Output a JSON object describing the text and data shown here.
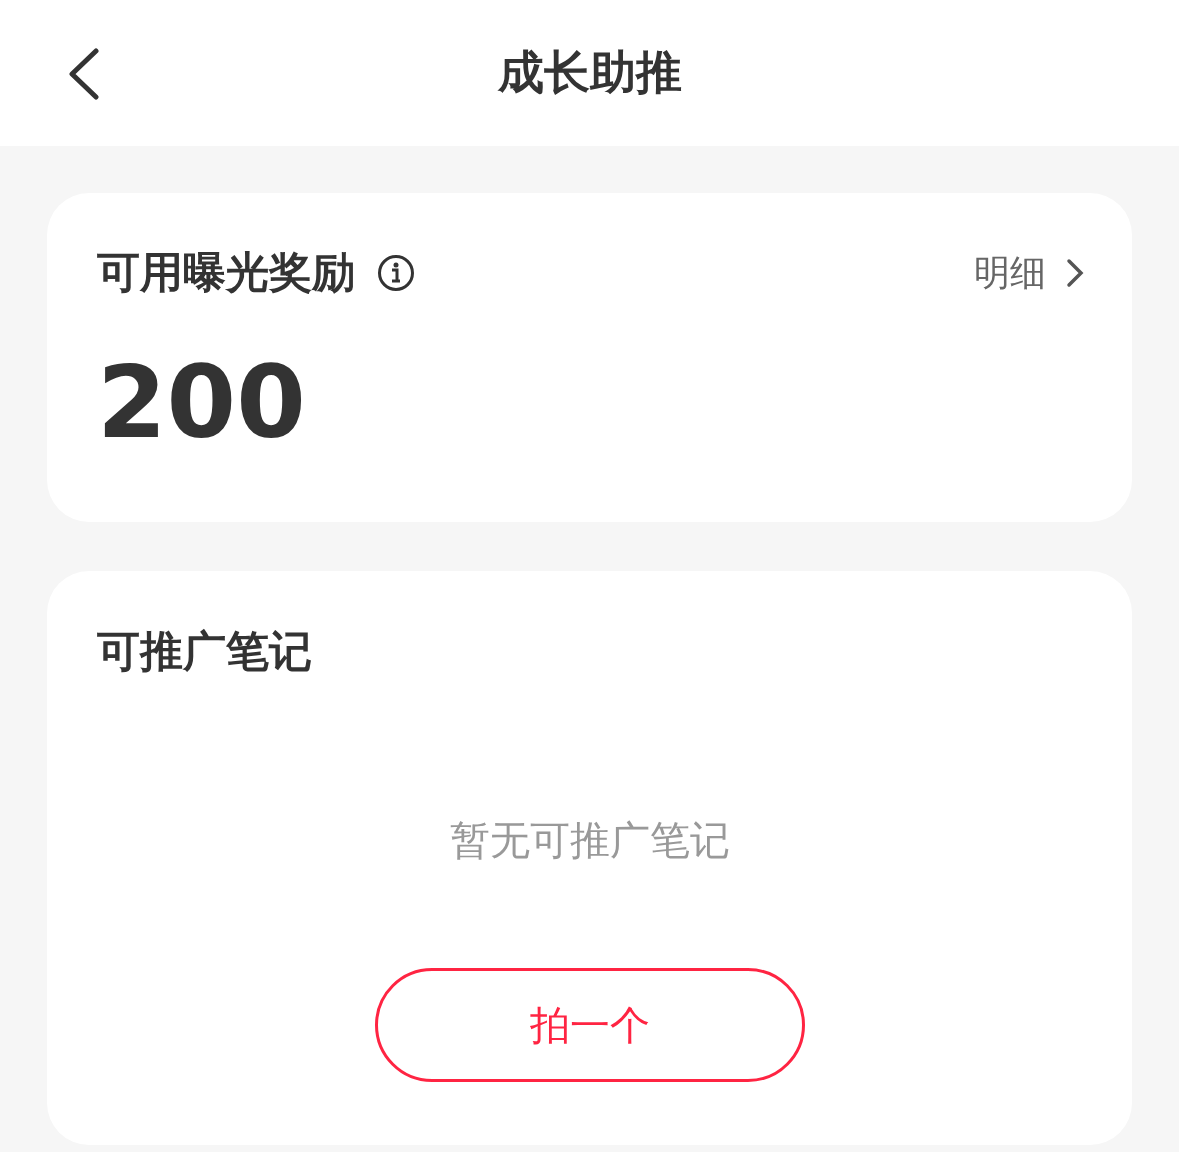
{
  "header": {
    "title": "成长助推"
  },
  "reward_card": {
    "title": "可用曝光奖励",
    "detail_link": "明细",
    "amount": "200"
  },
  "notes_card": {
    "title": "可推广笔记",
    "empty_message": "暂无可推广笔记",
    "action_button": "拍一个"
  }
}
